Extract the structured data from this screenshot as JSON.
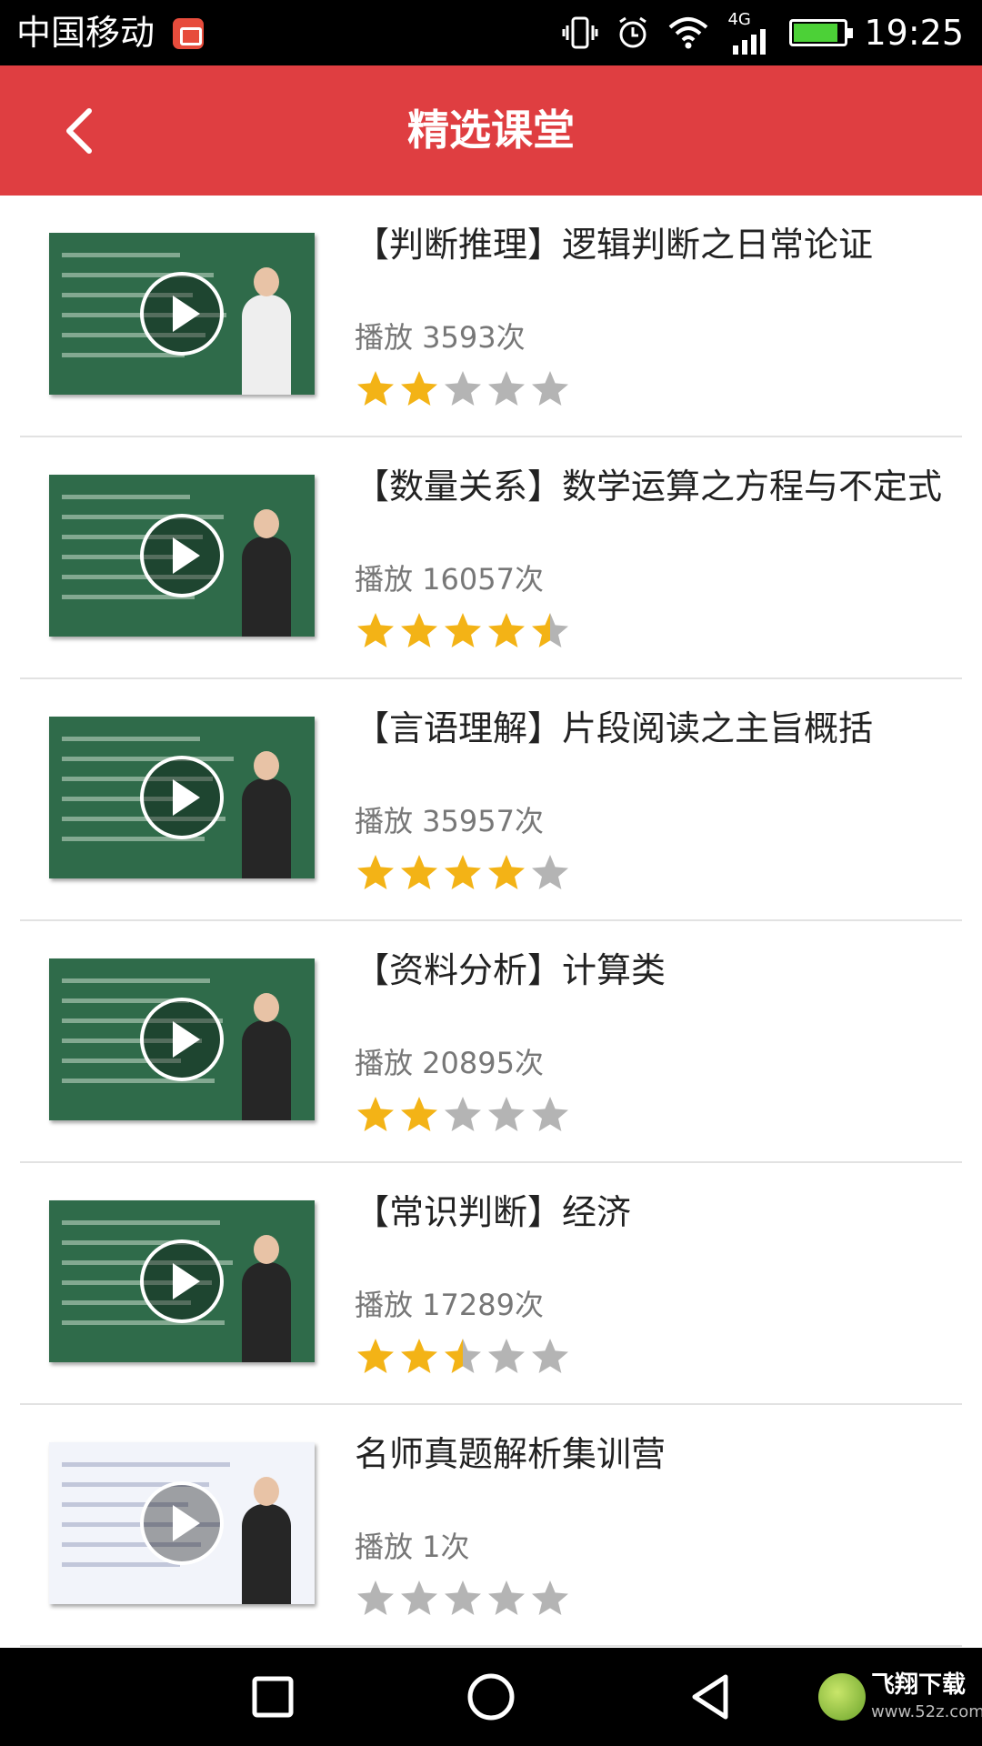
{
  "status_bar": {
    "carrier": "中国移动",
    "network": "4G",
    "time": "19:25"
  },
  "header": {
    "title": "精选课堂"
  },
  "courses": [
    {
      "title": "【判断推理】逻辑判断之日常论证",
      "plays": "播放 3593次",
      "rating": 2
    },
    {
      "title": "【数量关系】数学运算之方程与不定式",
      "plays": "播放 16057次",
      "rating": 4.5
    },
    {
      "title": "【言语理解】片段阅读之主旨概括",
      "plays": "播放 35957次",
      "rating": 4
    },
    {
      "title": "【资料分析】计算类",
      "plays": "播放 20895次",
      "rating": 2
    },
    {
      "title": "【常识判断】经济",
      "plays": "播放 17289次",
      "rating": 2.5
    },
    {
      "title": "名师真题解析集训营",
      "plays": "播放 1次",
      "rating": 0
    }
  ],
  "colors": {
    "header": "#df3e41",
    "star_on": "#f3b316",
    "star_off": "#b4b4b4"
  },
  "watermark": {
    "text": "飞翔下载",
    "url": "www.52z.com"
  }
}
